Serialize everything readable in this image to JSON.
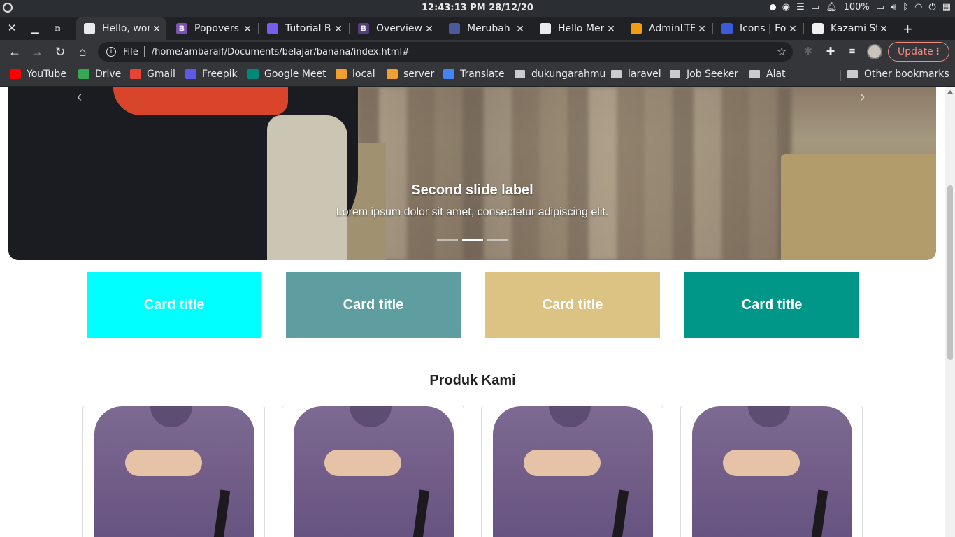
{
  "system": {
    "clock": "12:43:13 PM  28/12/20",
    "battery": "100%"
  },
  "tabs": [
    {
      "title": "Hello, wor",
      "fav_color": "#e8eaed",
      "active": true
    },
    {
      "title": "Popovers",
      "fav_color": "#7952b3",
      "fav_letter": "B"
    },
    {
      "title": "Tutorial B",
      "fav_color": "#7a5cf0"
    },
    {
      "title": "Overview",
      "fav_color": "#563d7c",
      "fav_letter": "B"
    },
    {
      "title": "Merubah",
      "fav_color": "#4a5a9a"
    },
    {
      "title": "Hello Mer",
      "fav_color": "#e8eaed"
    },
    {
      "title": "AdminLTE",
      "fav_color": "#f39c12"
    },
    {
      "title": "Icons | Fo",
      "fav_color": "#3b5bdb"
    },
    {
      "title": "Kazami St",
      "fav_color": "#f0f0f0"
    }
  ],
  "toolbar": {
    "file_label": "File",
    "url": "/home/ambaraif/Documents/belajar/banana/index.html#",
    "update_label": "Update"
  },
  "bookmarks": [
    {
      "label": "YouTube",
      "icon": "youtube-icon",
      "color": "#ff0000"
    },
    {
      "label": "Drive",
      "icon": "drive-icon",
      "color": "#34a853"
    },
    {
      "label": "Gmail",
      "icon": "gmail-icon",
      "color": "#ea4335"
    },
    {
      "label": "Freepik",
      "icon": "freepik-icon",
      "color": "#5b5be6"
    },
    {
      "label": "Google Meet",
      "icon": "meet-icon",
      "color": "#00897b"
    },
    {
      "label": "local",
      "icon": "xampp-icon",
      "color": "#f0a030"
    },
    {
      "label": "server",
      "icon": "xampp-icon",
      "color": "#f0a030"
    },
    {
      "label": "Translate",
      "icon": "translate-icon",
      "color": "#4285f4"
    },
    {
      "label": "dukungarahmu",
      "icon": "folder-icon"
    },
    {
      "label": "laravel",
      "icon": "folder-icon"
    },
    {
      "label": "Job Seeker",
      "icon": "folder-icon"
    },
    {
      "label": "Alat",
      "icon": "folder-icon"
    },
    {
      "label": "Other bookmarks",
      "icon": "folder-icon"
    }
  ],
  "carousel": {
    "title": "Second slide label",
    "text": "Lorem ipsum dolor sit amet, consectetur adipiscing elit.",
    "active_index": 1,
    "count": 3
  },
  "cards": [
    {
      "title": "Card title",
      "color": "#00ffff"
    },
    {
      "title": "Card title",
      "color": "#5f9ea0"
    },
    {
      "title": "Card title",
      "color": "#dcc283"
    },
    {
      "title": "Card title",
      "color": "#009688"
    }
  ],
  "products": {
    "heading": "Produk Kami",
    "count": 4
  }
}
